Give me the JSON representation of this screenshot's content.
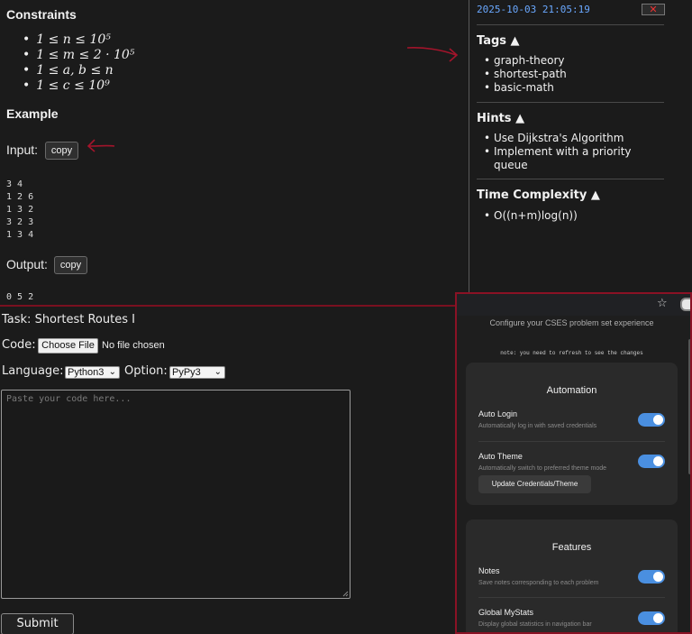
{
  "statement": {
    "constraints_heading": "Constraints",
    "constraints": [
      "1 ≤ n ≤ 10⁵",
      "1 ≤ m ≤ 2 · 10⁵",
      "1 ≤ a, b ≤ n",
      "1 ≤ c ≤ 10⁹"
    ],
    "example_heading": "Example",
    "input_label": "Input:",
    "copy_label": "copy",
    "input_lines": [
      "3 4",
      "1 2 6",
      "1 3 2",
      "3 2 3",
      "1 3 4"
    ],
    "output_label": "Output:",
    "output_lines": [
      "0 5 2"
    ]
  },
  "sidebar": {
    "timestamp": "2025-10-03 21:05:19",
    "close_label": "✕",
    "tags_heading": "Tags ▲",
    "tags": [
      "graph-theory",
      "shortest-path",
      "basic-math"
    ],
    "hints_heading": "Hints ▲",
    "hints": [
      "Use Dijkstra's Algorithm",
      "Implement with a priority queue"
    ],
    "complexity_heading": "Time Complexity ▲",
    "complexity": [
      "O((n+m)log(n))"
    ]
  },
  "form": {
    "task_label": "Task: Shortest Routes I",
    "code_label": "Code:",
    "choose_file_label": "Choose File",
    "no_file_label": "No file chosen",
    "language_label": "Language:",
    "language_value": "Python3",
    "option_label": "Option:",
    "option_value": "PyPy3",
    "code_placeholder": "Paste your code here...",
    "submit_label": "Submit"
  },
  "popup": {
    "subtitle": "Configure your CSES problem set experience",
    "note": "note: you need to refresh to see the changes",
    "ext_icon": "extension-icon",
    "automation": {
      "title": "Automation",
      "auto_login_label": "Auto Login",
      "auto_login_desc": "Automatically log in with saved credentials",
      "auto_login_on": true,
      "auto_theme_label": "Auto Theme",
      "auto_theme_desc": "Automatically switch to preferred theme mode",
      "auto_theme_on": true,
      "update_button": "Update Credentials/Theme"
    },
    "features": {
      "title": "Features",
      "notes_label": "Notes",
      "notes_desc": "Save notes corresponding to each problem",
      "notes_on": true,
      "mystats_label": "Global MyStats",
      "mystats_desc": "Display global statistics in navigation bar",
      "mystats_on": true
    },
    "toggle_color": "#4a8fe0",
    "accent_border_color": "#8a1225"
  }
}
